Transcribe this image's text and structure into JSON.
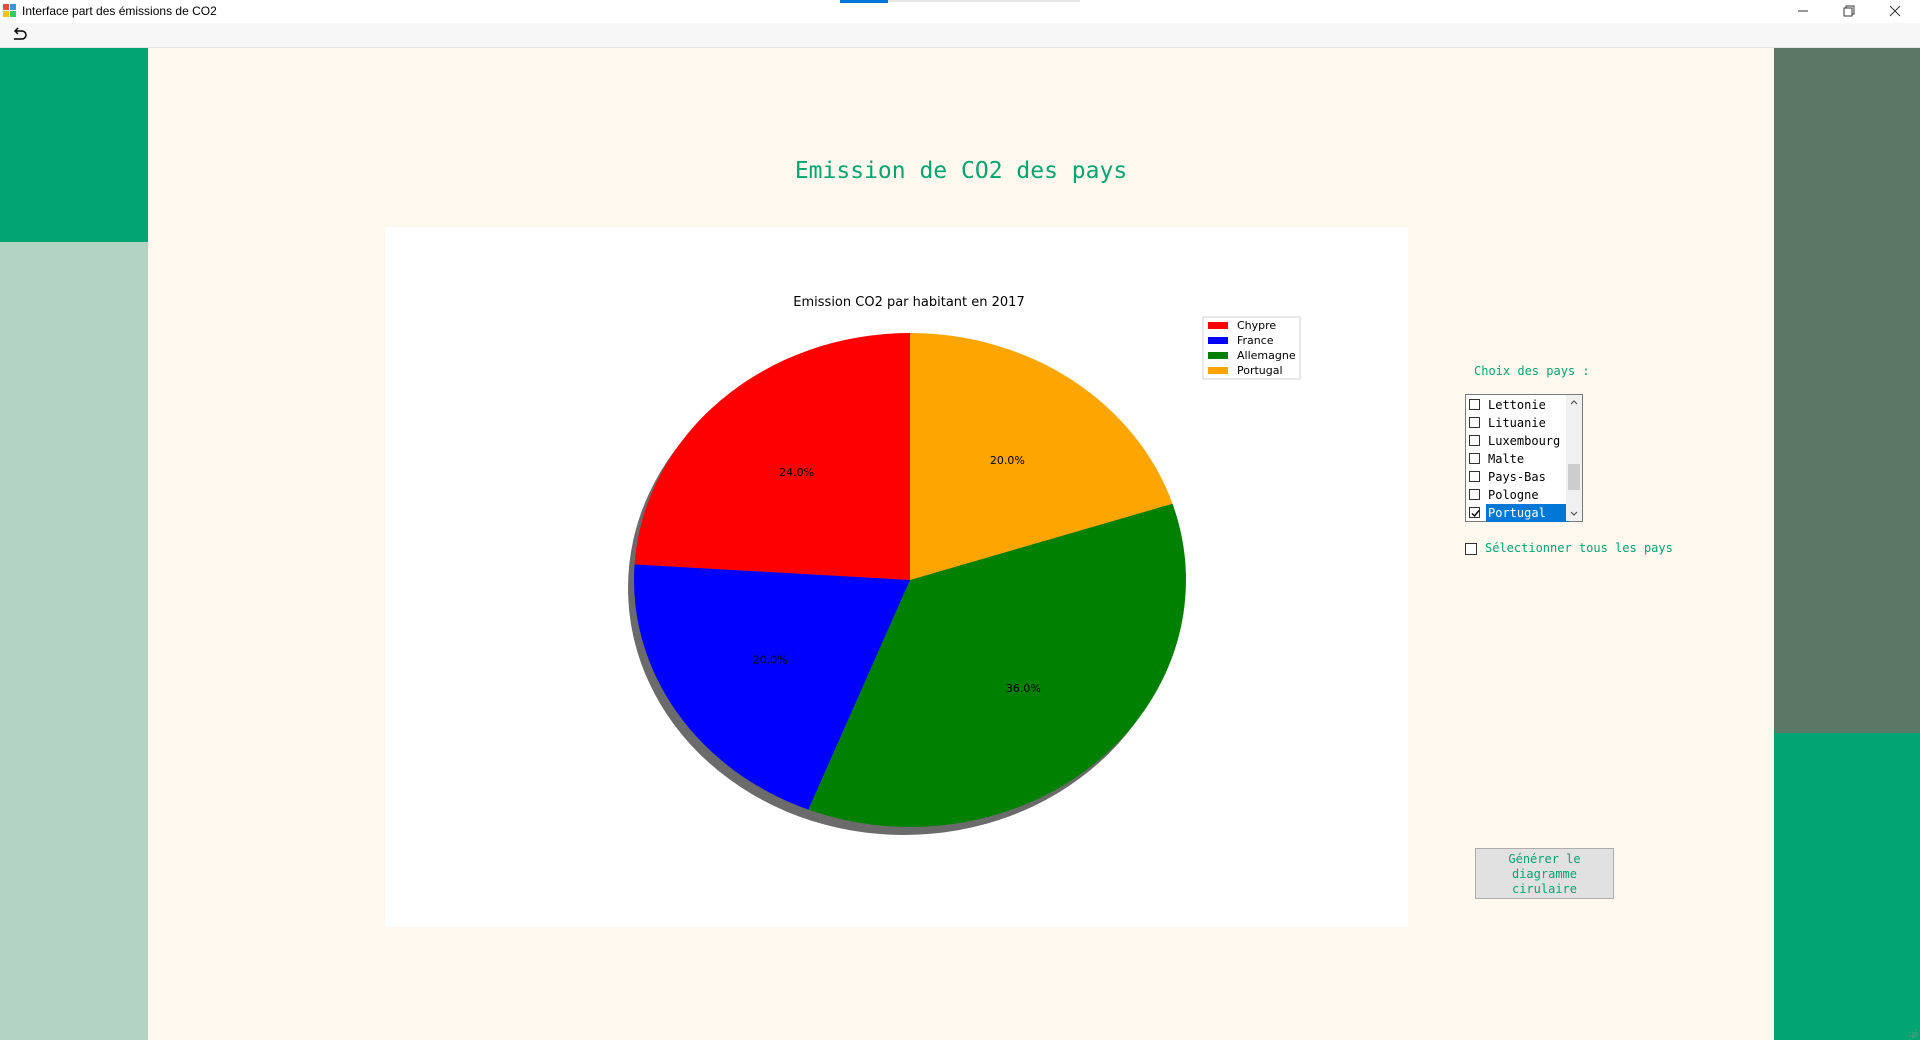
{
  "window": {
    "title": "Interface part des émissions de CO2"
  },
  "toolbar": {
    "undo_icon": "undo-icon"
  },
  "main": {
    "heading": "Emission de CO2 des pays"
  },
  "chart_data": {
    "type": "pie",
    "title": "Emission CO2 par habitant en 2017",
    "legend_position": "top-right",
    "shadow": true,
    "slices": [
      {
        "label": "Chypre",
        "value": 24.0,
        "text": "24.0%",
        "color": "#ff0000"
      },
      {
        "label": "France",
        "value": 20.0,
        "text": "20.0%",
        "color": "#0000ff"
      },
      {
        "label": "Allemagne",
        "value": 36.0,
        "text": "36.0%",
        "color": "#008000"
      },
      {
        "label": "Portugal",
        "value": 20.0,
        "text": "20.0%",
        "color": "#ffa500"
      }
    ]
  },
  "controls": {
    "choice_label": "Choix des pays :",
    "countries": [
      {
        "name": "Lettonie",
        "checked": false,
        "selected": false
      },
      {
        "name": "Lituanie",
        "checked": false,
        "selected": false
      },
      {
        "name": "Luxembourg",
        "checked": false,
        "selected": false
      },
      {
        "name": "Malte",
        "checked": false,
        "selected": false
      },
      {
        "name": "Pays-Bas",
        "checked": false,
        "selected": false
      },
      {
        "name": "Pologne",
        "checked": false,
        "selected": false
      },
      {
        "name": "Portugal",
        "checked": true,
        "selected": true
      }
    ],
    "select_all_label": "Sélectionner tous les pays",
    "select_all_checked": false,
    "generate_line1": "Générer le",
    "generate_line2": "diagramme",
    "generate_line3": "cirulaire"
  },
  "colors": {
    "accent_green": "#00a572",
    "panel_light_green": "#b4d4c3",
    "panel_dark_green": "#5b7866",
    "background": "#fff8ef",
    "selection_blue": "#0078d7"
  }
}
